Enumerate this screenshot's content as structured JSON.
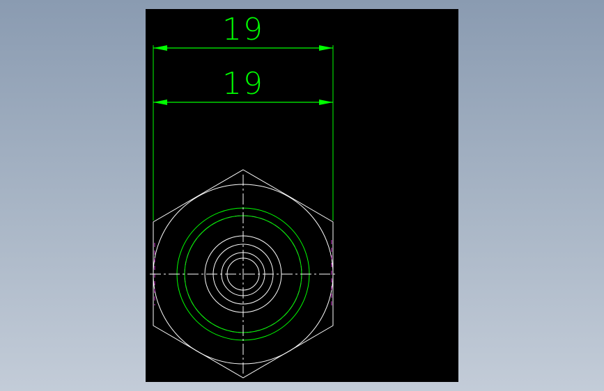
{
  "colors": {
    "background": "#000000",
    "desktop": "#a0aec0",
    "geometry": "#ffffff",
    "dimension": "#00ff00",
    "hidden": "#cc33cc"
  },
  "dimensions": [
    {
      "label": "19"
    },
    {
      "label": "19"
    }
  ]
}
